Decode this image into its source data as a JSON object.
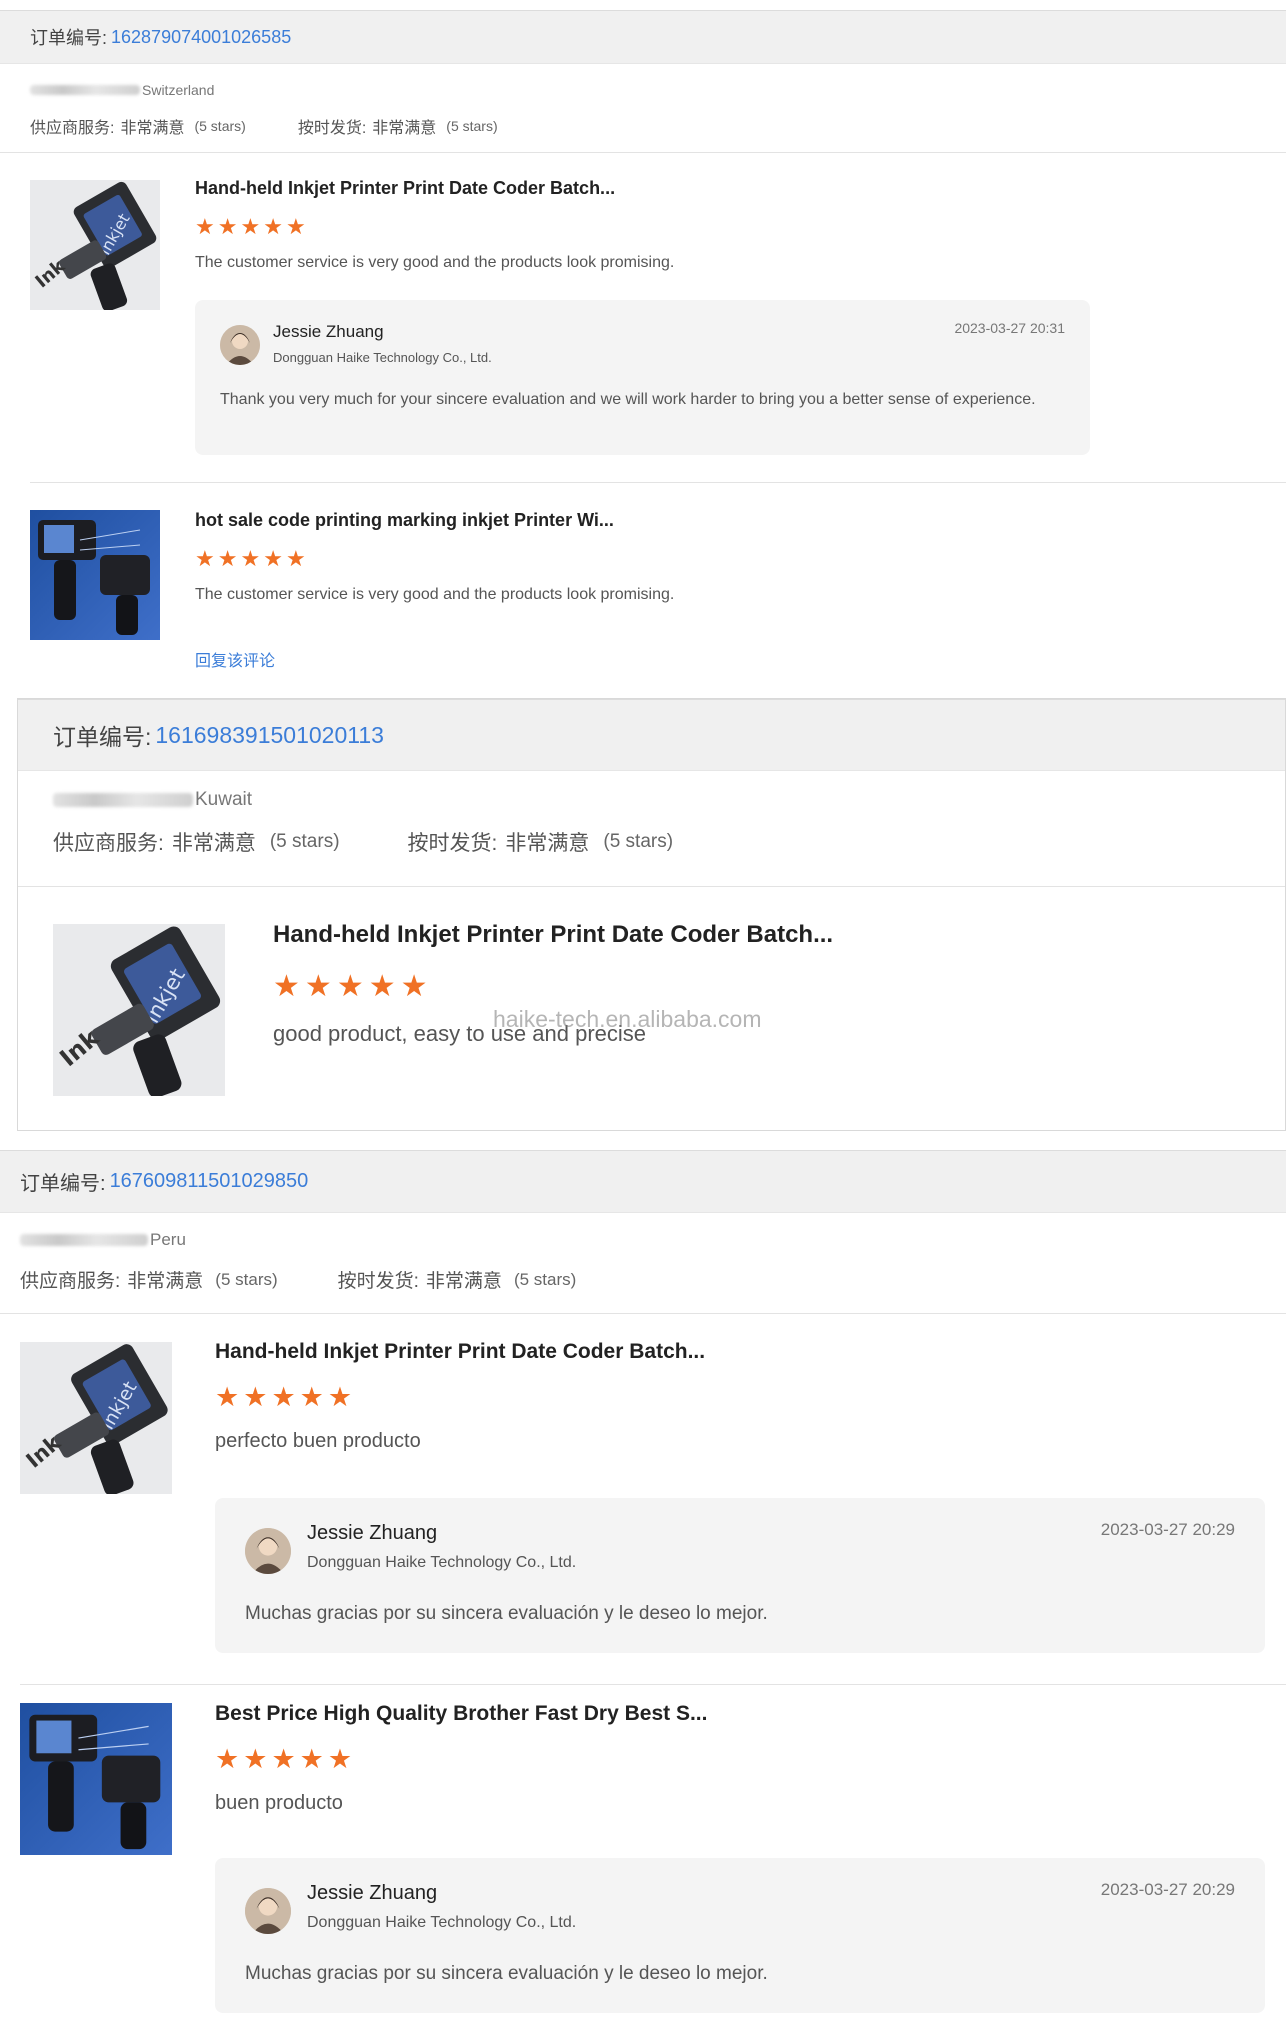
{
  "orders": [
    {
      "order_label": "订单编号:",
      "order_no": "162879074001026585",
      "buyer_country": "Switzerland",
      "supplier_service_label": "供应商服务:",
      "supplier_service_value": "非常满意",
      "supplier_service_stars": "(5 stars)",
      "shipping_label": "按时发货:",
      "shipping_value": "非常满意",
      "shipping_stars": "(5 stars)",
      "items": [
        {
          "title": "Hand-held Inkjet Printer Print Date Coder Batch...",
          "rating": 5,
          "review": "The customer service is very good and the products look promising.",
          "reply": {
            "name": "Jessie Zhuang",
            "company": "Dongguan Haike Technology Co., Ltd.",
            "date": "2023-03-27 20:31",
            "message": "Thank you very much for your sincere evaluation and we will work harder to bring you a better sense of experience."
          }
        },
        {
          "title": "hot sale code printing marking inkjet Printer Wi...",
          "rating": 5,
          "review": "The customer service is very good and the products look promising.",
          "reply_link": "回复该评论"
        }
      ]
    },
    {
      "order_label": "订单编号:",
      "order_no": "161698391501020113",
      "buyer_country": "Kuwait",
      "supplier_service_label": "供应商服务:",
      "supplier_service_value": "非常满意",
      "supplier_service_stars": "(5 stars)",
      "shipping_label": "按时发货:",
      "shipping_value": "非常满意",
      "shipping_stars": "(5 stars)",
      "items": [
        {
          "title": "Hand-held Inkjet Printer Print Date Coder Batch...",
          "rating": 5,
          "review": "good product, easy to use and precise"
        }
      ],
      "watermark": "haike-tech.en.alibaba.com"
    },
    {
      "order_label": "订单编号:",
      "order_no": "167609811501029850",
      "buyer_country": "Peru",
      "supplier_service_label": "供应商服务:",
      "supplier_service_value": "非常满意",
      "supplier_service_stars": "(5 stars)",
      "shipping_label": "按时发货:",
      "shipping_value": "非常满意",
      "shipping_stars": "(5 stars)",
      "items": [
        {
          "title": "Hand-held Inkjet Printer Print Date Coder Batch...",
          "rating": 5,
          "review": "perfecto buen producto",
          "reply": {
            "name": "Jessie Zhuang",
            "company": "Dongguan Haike Technology Co., Ltd.",
            "date": "2023-03-27 20:29",
            "message": "Muchas gracias por su sincera evaluación y le deseo lo mejor."
          }
        },
        {
          "title": "Best Price High Quality Brother Fast Dry Best S...",
          "rating": 5,
          "review": "buen producto",
          "reply": {
            "name": "Jessie Zhuang",
            "company": "Dongguan Haike Technology Co., Ltd.",
            "date": "2023-03-27 20:29",
            "message": "Muchas gracias por su sincera evaluación y le deseo lo mejor."
          }
        }
      ]
    }
  ],
  "thumb_text": "inkjet",
  "colors": {
    "accent_link": "#3b7dd8",
    "star": "#f07125",
    "header_bg": "#f0f0f0",
    "reply_bg": "#f4f4f4"
  }
}
